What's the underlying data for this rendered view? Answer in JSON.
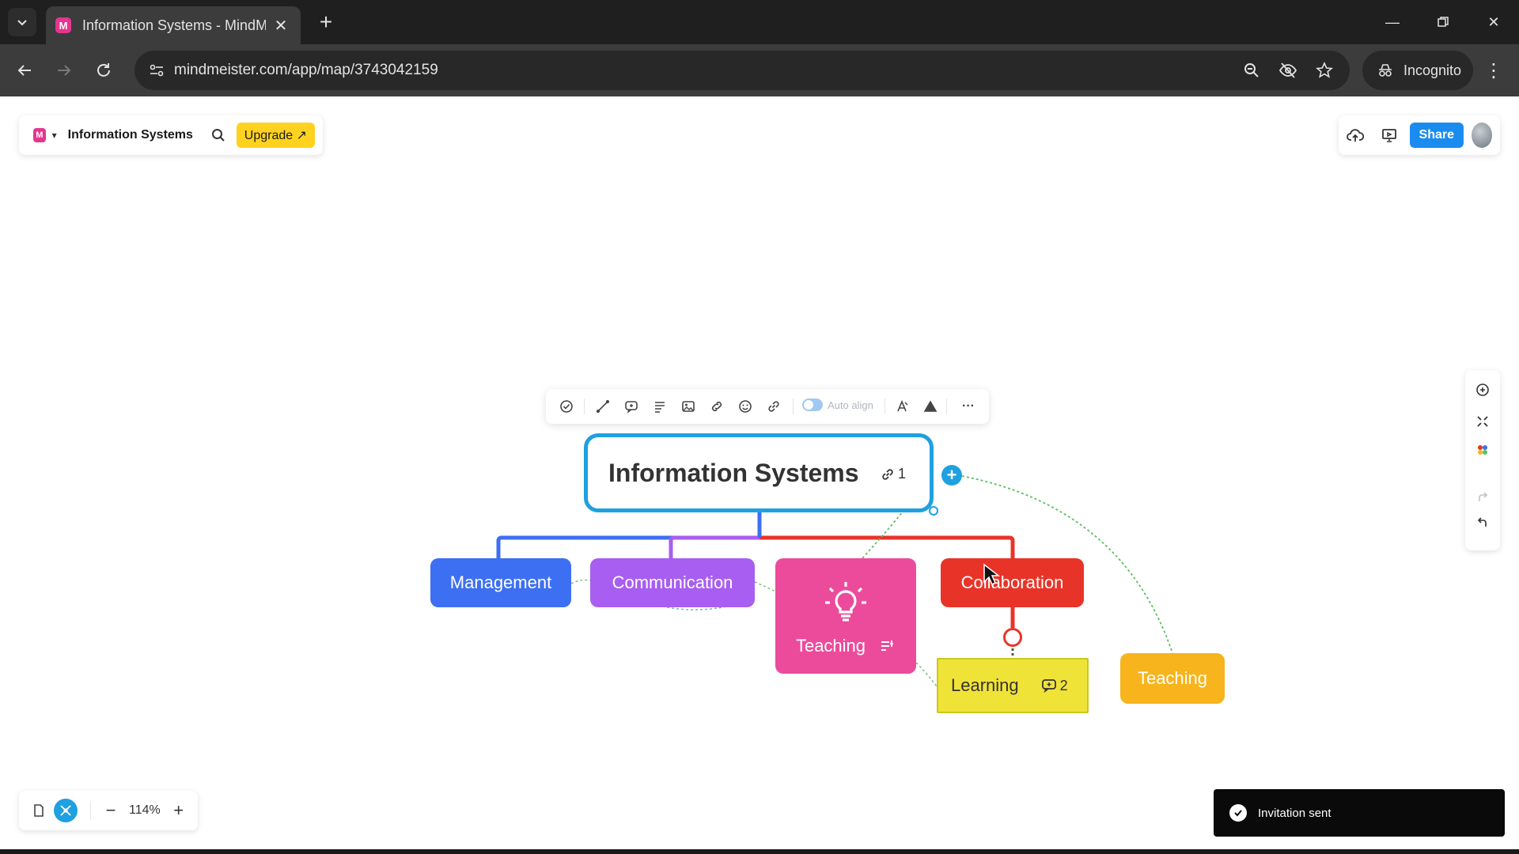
{
  "browser": {
    "tab_title": "Information Systems - MindMe",
    "url": "mindmeister.com/app/map/3743042159",
    "incognito_label": "Incognito",
    "favicon_letter": "M"
  },
  "app": {
    "map_title": "Information Systems",
    "upgrade_label": "Upgrade ↗",
    "share_label": "Share",
    "logo_letter": "M"
  },
  "toolbar": {
    "autoalign_label": "Auto align",
    "more_label": "···"
  },
  "nodes": {
    "root": {
      "label": "Information Systems",
      "link_count": "1"
    },
    "management": {
      "label": "Management"
    },
    "communication": {
      "label": "Communication"
    },
    "teaching_main": {
      "label": "Teaching"
    },
    "collaboration": {
      "label": "Collaboration"
    },
    "learning": {
      "label": "Learning",
      "comment_count": "2"
    },
    "teaching_float": {
      "label": "Teaching"
    }
  },
  "zoom": {
    "level": "114%",
    "minus": "−",
    "plus": "+"
  },
  "toast": {
    "message": "Invitation sent"
  },
  "colors": {
    "root_border": "#1fa0e0",
    "management": "#3d6ff2",
    "communication": "#a85ef0",
    "teaching_main": "#ec4b9b",
    "collaboration": "#e83428",
    "learning": "#f0e338",
    "teaching_float": "#f7b41c",
    "upgrade": "#ffd21f",
    "share": "#1a8cf0"
  },
  "icons": {
    "toolbar": [
      "check-circle-icon",
      "connector-icon",
      "note-icon",
      "text-align-icon",
      "image-icon",
      "link-icon",
      "emoji-icon",
      "attach-link-icon",
      "style-icon",
      "shape-icon",
      "more-icon"
    ],
    "right_rail": [
      "focus-icon",
      "collapse-icon",
      "palette-icon",
      "redo-icon",
      "undo-icon"
    ]
  }
}
